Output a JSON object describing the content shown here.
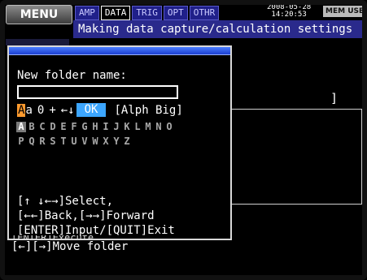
{
  "topbar": {
    "menu_label": "MENU",
    "tabs": [
      {
        "label": "AMP",
        "active": false
      },
      {
        "label": "DATA",
        "active": true
      },
      {
        "label": "TRIG",
        "active": false
      },
      {
        "label": "OPT",
        "active": false
      },
      {
        "label": "OTHR",
        "active": false
      }
    ],
    "date": "2008-05-28",
    "time": "14:20:53",
    "mem_usb": "MEM USB"
  },
  "status_line": "Making data capture/calculation settings",
  "background": {
    "bracket": "]",
    "bottom_partial": "[ENTER]Execute",
    "move_folder": "[←][→]Move folder"
  },
  "dialog": {
    "prompt": "New folder name:",
    "input_value": "",
    "mode_row": {
      "upper_char": "A",
      "lower_char": "a",
      "digit_char": "0",
      "symbol_char": "+",
      "left_arrow": "←",
      "down_arrow": "↓",
      "ok_label": "OK",
      "mode_label": "[Alph Big]"
    },
    "char_rows": [
      [
        "A",
        "B",
        "C",
        "D",
        "E",
        "F",
        "G",
        "H",
        "I",
        "J",
        "K",
        "L",
        "M",
        "N",
        "O"
      ],
      [
        "P",
        "Q",
        "R",
        "S",
        "T",
        "U",
        "V",
        "W",
        "X",
        "Y",
        "Z"
      ]
    ],
    "selected_char": "A",
    "help": [
      "[↑ ↓←→]Select,",
      "[←←]Back,[→→]Forward",
      "[ENTER]Input/[QUIT]Exit"
    ]
  },
  "colors": {
    "title_blue": "#2a2a8c",
    "ok_blue": "#3ca6ff",
    "cursor_orange": "#ff9a2e"
  }
}
